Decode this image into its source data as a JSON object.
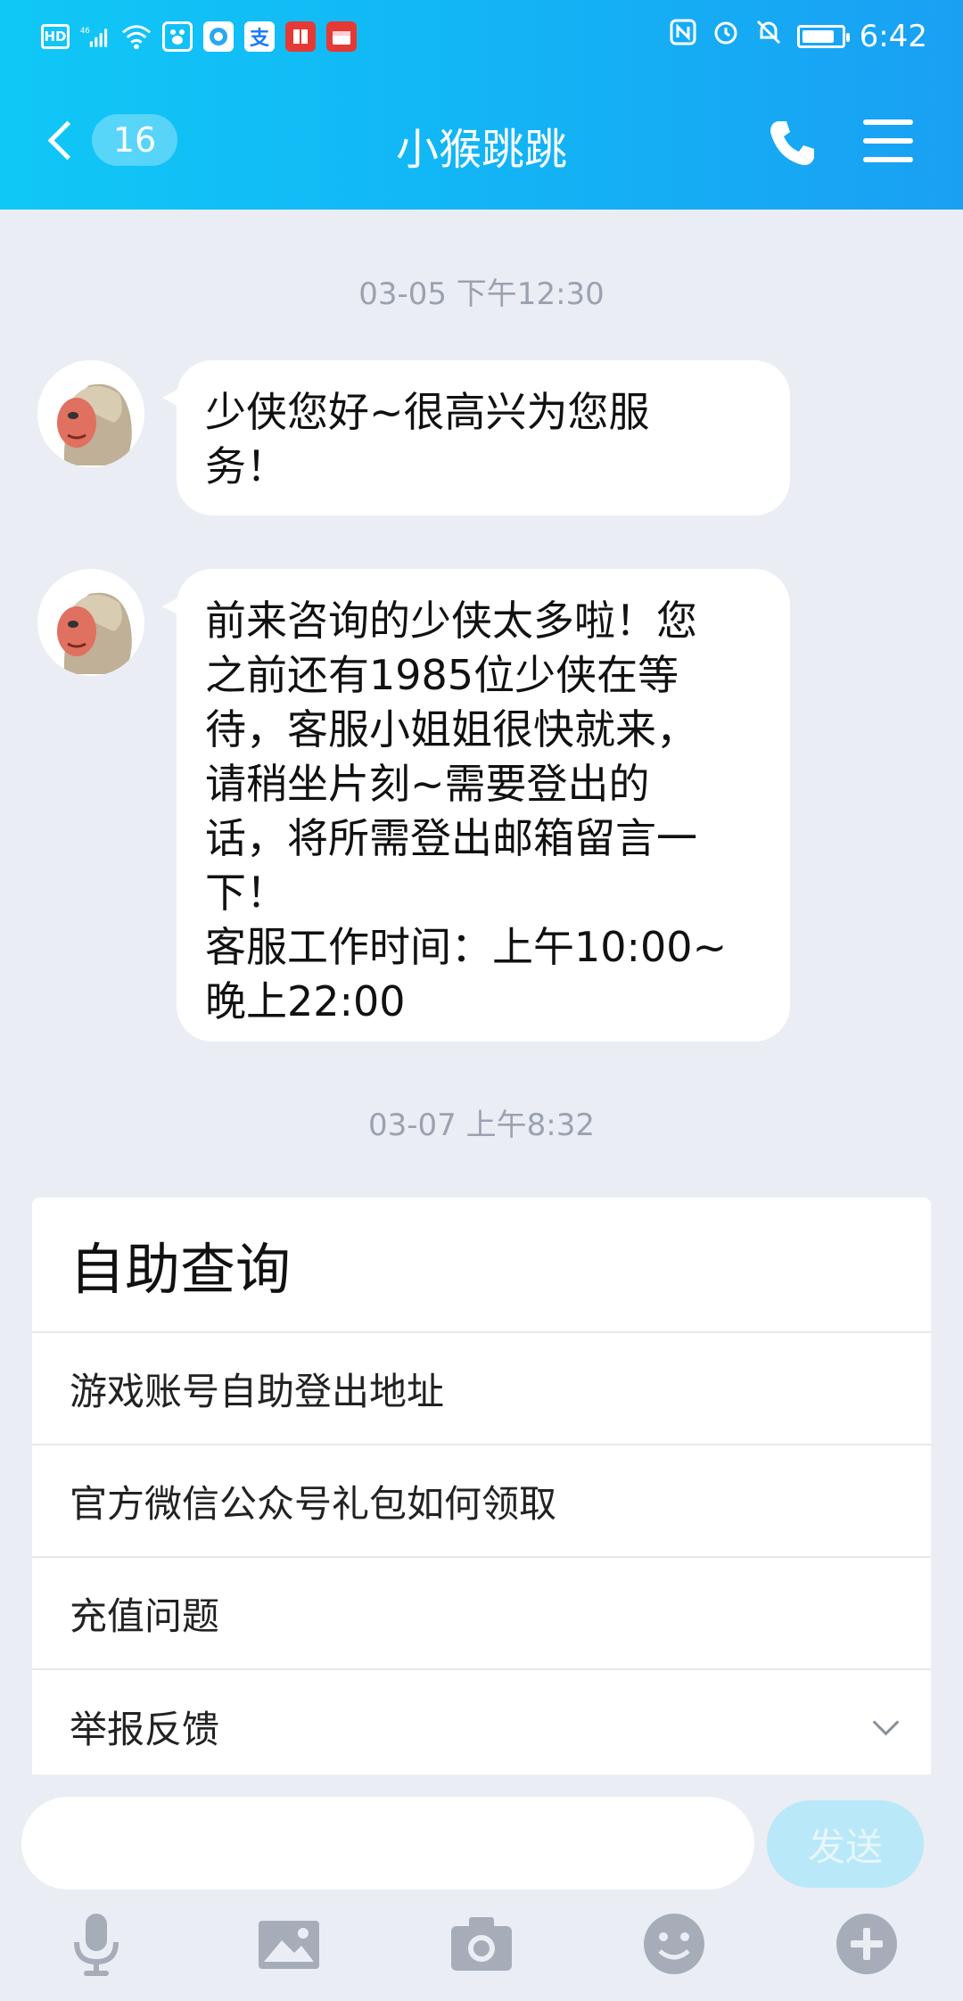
{
  "status_bar": {
    "hd": "HD",
    "signal_label": "46",
    "time": "6:42",
    "battery_level": 0.85,
    "app_icons": [
      {
        "name": "baidu-icon",
        "color": "#ffffff"
      },
      {
        "name": "qq-browser-icon",
        "color": "#ffffff"
      },
      {
        "name": "alipay-icon",
        "glyph": "支",
        "color": "#1677ff"
      },
      {
        "name": "reader-icon",
        "color": "#e53935"
      },
      {
        "name": "calendar-app-icon",
        "color": "#e53935"
      }
    ]
  },
  "header": {
    "unread_count": "16",
    "title": "小猴跳跳",
    "accent_color": "#13b3f5"
  },
  "messages": [
    {
      "time": "03-05 下午12:30"
    },
    {
      "text": "少侠您好~很高兴为您服\n务！"
    },
    {
      "text": "前来咨询的少侠太多啦！您\n之前还有1985位少侠在等\n待，客服小姐姐很快就来，\n请稍坐片刻~需要登出的\n话，将所需登出邮箱留言一\n下！\n客服工作时间：上午10:00~\n晚上22:00"
    },
    {
      "time": "03-07 上午8:32"
    }
  ],
  "self_service": {
    "title": "自助查询",
    "items": [
      {
        "label": "游戏账号自助登出地址"
      },
      {
        "label": "官方微信公众号礼包如何领取"
      },
      {
        "label": "充值问题"
      },
      {
        "label": "举报反馈"
      }
    ]
  },
  "input_bar": {
    "value": "",
    "send_label": "发送"
  },
  "toolbar": {
    "icons": [
      "microphone-icon",
      "image-icon",
      "camera-icon",
      "emoji-icon",
      "plus-icon"
    ]
  }
}
